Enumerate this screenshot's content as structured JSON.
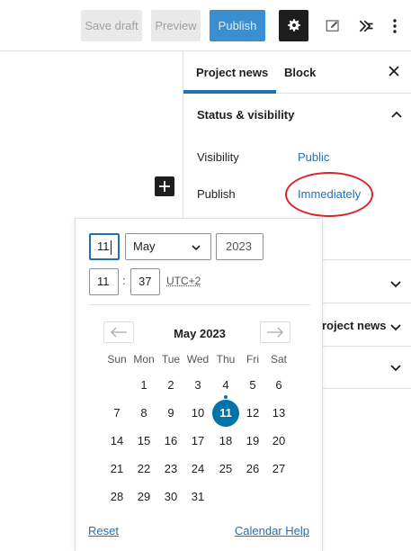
{
  "toolbar": {
    "save_draft": "Save draft",
    "preview": "Preview",
    "publish": "Publish",
    "icons": [
      "gear-icon",
      "edit-icon",
      "jetpack-icon",
      "more-vertical-icon"
    ]
  },
  "sidebar": {
    "tabs": [
      "Project news",
      "Block"
    ],
    "active_tab": "Project news",
    "status_panel": {
      "title": "Status & visibility",
      "visibility_label": "Visibility",
      "visibility_value": "Public",
      "publish_label": "Publish",
      "publish_value": "Immediately"
    },
    "partial_panel_text": "roject news"
  },
  "date_picker": {
    "day": "11",
    "month": "May",
    "year": "2023",
    "hour": "11",
    "minute": "37",
    "colon": ":",
    "timezone": "UTC+2",
    "month_label": "May 2023",
    "weekdays": [
      "Sun",
      "Mon",
      "Tue",
      "Wed",
      "Thu",
      "Fri",
      "Sat"
    ],
    "first_weekday_index": 1,
    "days_in_month": 31,
    "selected_day": 11,
    "today_day": 4,
    "reset": "Reset",
    "calendar_help": "Calendar Help"
  },
  "colors": {
    "accent": "#2271b1",
    "selected_day": "#0073aa",
    "annotation": "#d9262b"
  }
}
